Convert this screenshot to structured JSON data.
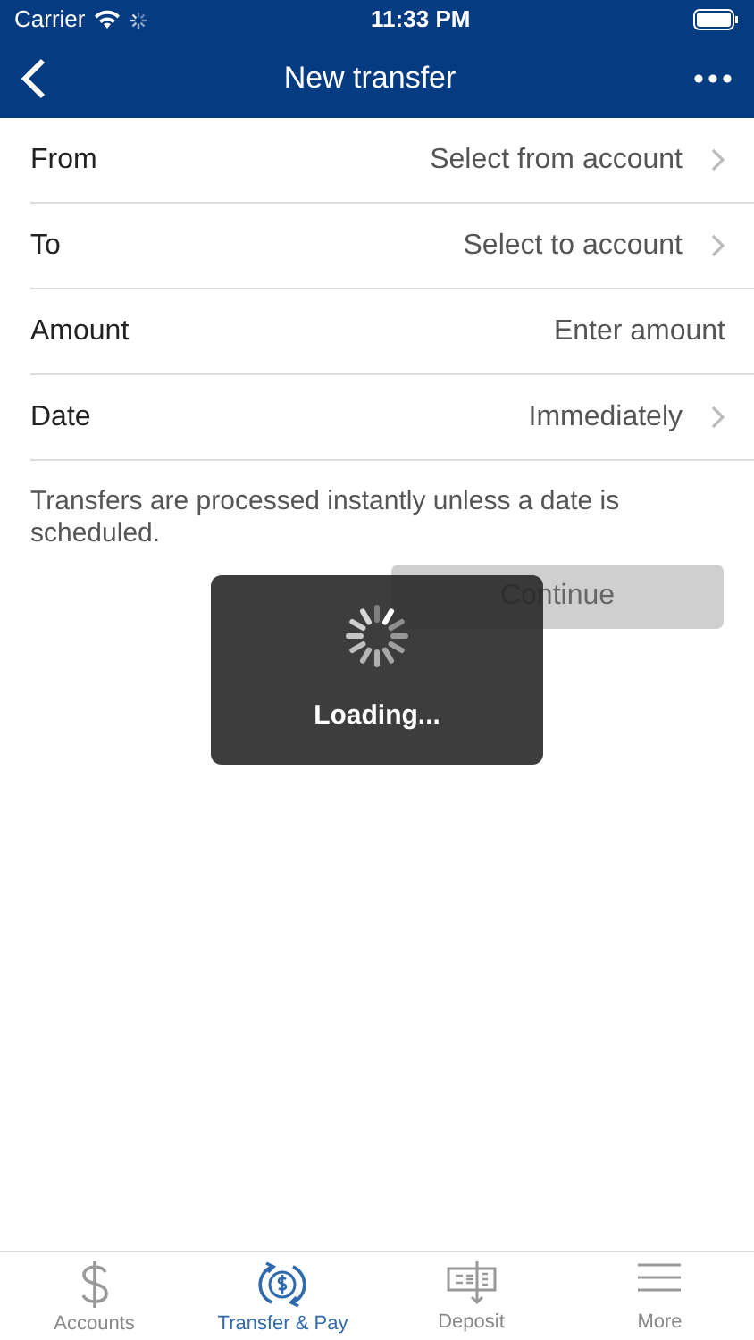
{
  "status_bar": {
    "carrier": "Carrier",
    "time": "11:33 PM"
  },
  "nav": {
    "title": "New transfer"
  },
  "fields": [
    {
      "kind": "select",
      "label": "From",
      "placeholder": "Select from account"
    },
    {
      "kind": "select",
      "label": "To",
      "placeholder": "Select to account"
    },
    {
      "kind": "input",
      "label": "Amount",
      "placeholder": "Enter amount"
    },
    {
      "kind": "select",
      "label": "Date",
      "value": "Immediately"
    }
  ],
  "note": "Transfers are processed instantly unless a date is scheduled.",
  "continue_button": {
    "label": "Continue",
    "disabled": true
  },
  "loading": {
    "label": "Loading..."
  },
  "tabs": [
    {
      "kind": "accounts",
      "label": "Accounts",
      "selected": false
    },
    {
      "kind": "transfer",
      "label": "Transfer & Pay",
      "selected": true
    },
    {
      "kind": "deposit",
      "label": "Deposit",
      "selected": false
    },
    {
      "kind": "more",
      "label": "More",
      "selected": false
    }
  ]
}
